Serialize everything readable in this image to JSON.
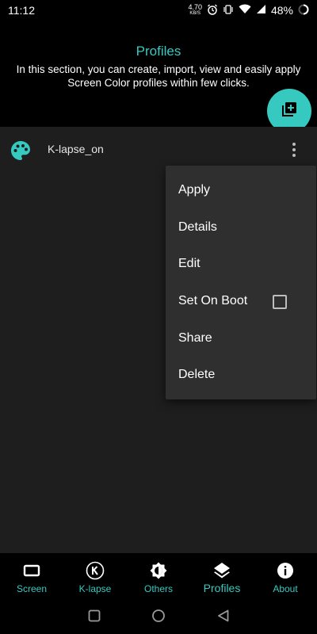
{
  "status_bar": {
    "time": "11:12",
    "net_speed": "4.70",
    "net_unit": "KB/S",
    "battery": "48%"
  },
  "header": {
    "title": "Profiles",
    "description": "In this section, you can create, import, view and easily apply Screen Color profiles within few clicks."
  },
  "profiles": [
    {
      "name": "K-lapse_on"
    }
  ],
  "menu": {
    "items": [
      {
        "label": "Apply"
      },
      {
        "label": "Details"
      },
      {
        "label": "Edit"
      },
      {
        "label": "Set On Boot",
        "checkbox": false
      },
      {
        "label": "Share"
      },
      {
        "label": "Delete"
      }
    ]
  },
  "bottom_nav": {
    "items": [
      {
        "label": "Screen",
        "icon": "screen-icon"
      },
      {
        "label": "K-lapse",
        "icon": "k-circle-icon"
      },
      {
        "label": "Others",
        "icon": "brightness-icon"
      },
      {
        "label": "Profiles",
        "icon": "layers-icon",
        "active": true
      },
      {
        "label": "About",
        "icon": "info-icon"
      }
    ]
  },
  "colors": {
    "accent": "#36c9c0",
    "background": "#000000",
    "surface": "#1e1e1e",
    "menu": "#2f2f2f"
  }
}
